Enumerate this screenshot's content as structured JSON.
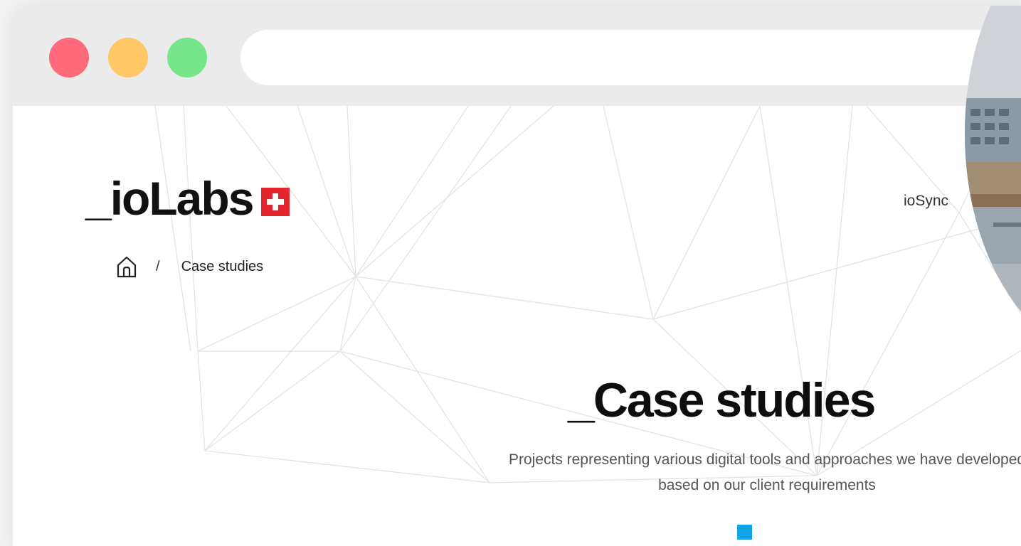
{
  "window": {
    "controls": [
      "close",
      "minimize",
      "maximize"
    ],
    "colors": {
      "close": "#ff6b7a",
      "minimize": "#ffc766",
      "maximize": "#75e689"
    }
  },
  "header": {
    "logo_text": "_ioLabs",
    "logo_flag_icon": "swiss-flag-icon",
    "nav_item": "ioSync"
  },
  "breadcrumb": {
    "home_icon": "home-icon",
    "separator": "/",
    "current": "Case studies"
  },
  "hero": {
    "title": "_Case studies",
    "subtitle_line1": "Projects representing various digital tools and approaches we have developed",
    "subtitle_line2": "based on our client requirements"
  },
  "accent_color": "#12a4e6"
}
